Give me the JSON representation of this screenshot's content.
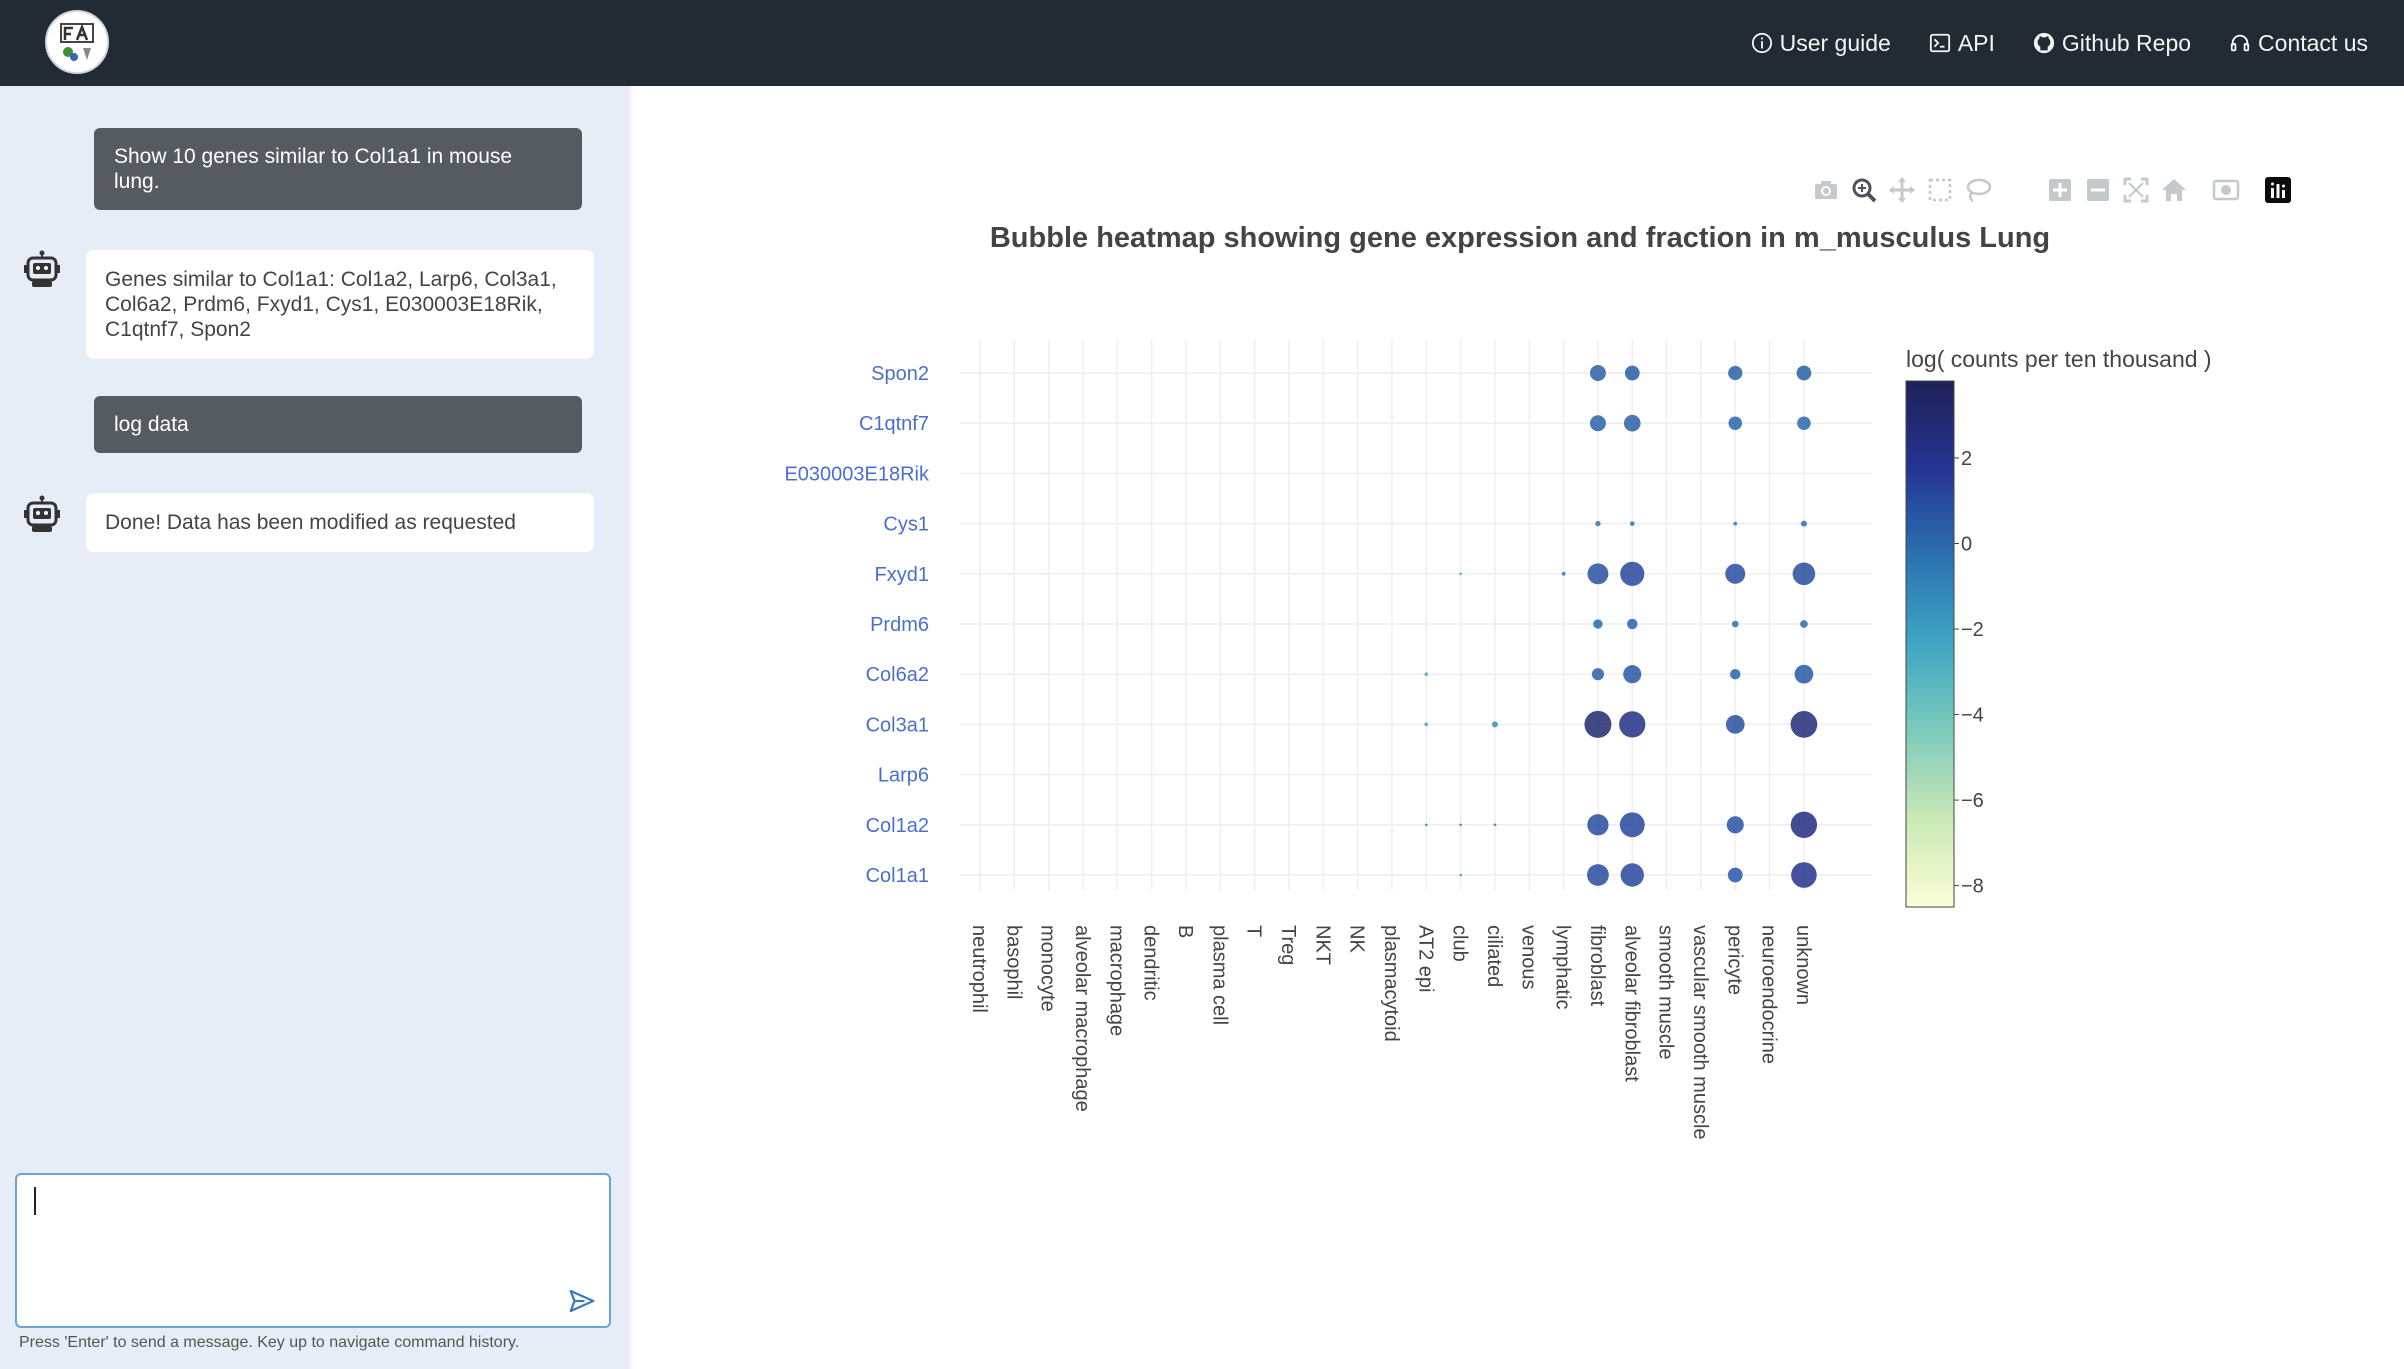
{
  "navbar": {
    "links": [
      {
        "label": "User guide",
        "icon": "info-icon"
      },
      {
        "label": "API",
        "icon": "terminal-icon"
      },
      {
        "label": "Github Repo",
        "icon": "github-icon"
      },
      {
        "label": "Contact us",
        "icon": "headset-icon"
      }
    ]
  },
  "chat": {
    "messages": [
      {
        "role": "user",
        "text": "Show 10 genes similar to Col1a1 in mouse lung."
      },
      {
        "role": "bot",
        "text": "Genes similar to Col1a1: Col1a2, Larp6, Col3a1, Col6a2, Prdm6, Fxyd1, Cys1, E030003E18Rik, C1qtnf7, Spon2"
      },
      {
        "role": "user",
        "text": "log data"
      },
      {
        "role": "bot",
        "text": "Done! Data has been modified as requested"
      }
    ],
    "input_value": "",
    "hint": "Press 'Enter' to send a message. Key up to navigate command history."
  },
  "modebar": {
    "icons": [
      "camera-icon",
      "zoom-icon",
      "pan-icon",
      "box-select-icon",
      "lasso-icon",
      "zoom-in-icon",
      "zoom-out-icon",
      "autoscale-icon",
      "home-icon",
      "screenshot-icon",
      "plotly-logo-icon"
    ],
    "active": "zoom-icon"
  },
  "chart_data": {
    "type": "bubble-heatmap",
    "title": "Bubble heatmap showing gene expression and fraction in m_musculus Lung",
    "genes": [
      "Spon2",
      "C1qtnf7",
      "E030003E18Rik",
      "Cys1",
      "Fxyd1",
      "Prdm6",
      "Col6a2",
      "Col3a1",
      "Larp6",
      "Col1a2",
      "Col1a1"
    ],
    "cell_types": [
      "neutrophil",
      "basophil",
      "monocyte",
      "alveolar macrophage",
      "macrophage",
      "dendritic",
      "B",
      "plasma cell",
      "T",
      "Treg",
      "NKT",
      "NK",
      "plasmacytoid",
      "AT2 epi",
      "club",
      "ciliated",
      "venous",
      "lymphatic",
      "fibroblast",
      "alveolar fibroblast",
      "smooth muscle",
      "vascular smooth muscle",
      "pericyte",
      "neuroendocrine",
      "unknown"
    ],
    "colorbar": {
      "title": "log( counts per ten thousand )",
      "range": [
        -8.5,
        3.8
      ],
      "ticks": [
        2,
        0,
        -2,
        -4,
        -6,
        -8
      ],
      "colorscale": [
        "#fcfdd6",
        "#c9e9b6",
        "#7dcbbb",
        "#3fa6c3",
        "#2b72b0",
        "#253494",
        "#1f2257"
      ]
    },
    "points": [
      {
        "gene": "Spon2",
        "cell": "fibroblast",
        "value": 0.3,
        "fraction": 0.35
      },
      {
        "gene": "Spon2",
        "cell": "alveolar fibroblast",
        "value": 0.5,
        "fraction": 0.3
      },
      {
        "gene": "Spon2",
        "cell": "pericyte",
        "value": 0.3,
        "fraction": 0.28
      },
      {
        "gene": "Spon2",
        "cell": "unknown",
        "value": 0.4,
        "fraction": 0.3
      },
      {
        "gene": "C1qtnf7",
        "cell": "fibroblast",
        "value": 0.2,
        "fraction": 0.35
      },
      {
        "gene": "C1qtnf7",
        "cell": "alveolar fibroblast",
        "value": 0.3,
        "fraction": 0.38
      },
      {
        "gene": "C1qtnf7",
        "cell": "pericyte",
        "value": 0.1,
        "fraction": 0.25
      },
      {
        "gene": "C1qtnf7",
        "cell": "unknown",
        "value": 0.1,
        "fraction": 0.25
      },
      {
        "gene": "Cys1",
        "cell": "fibroblast",
        "value": -0.5,
        "fraction": 0.04
      },
      {
        "gene": "Cys1",
        "cell": "alveolar fibroblast",
        "value": -0.5,
        "fraction": 0.03
      },
      {
        "gene": "Cys1",
        "cell": "pericyte",
        "value": -0.5,
        "fraction": 0.02
      },
      {
        "gene": "Cys1",
        "cell": "unknown",
        "value": -0.3,
        "fraction": 0.05
      },
      {
        "gene": "Fxyd1",
        "cell": "club",
        "value": -1.0,
        "fraction": 0.005
      },
      {
        "gene": "Fxyd1",
        "cell": "lymphatic",
        "value": -0.5,
        "fraction": 0.02
      },
      {
        "gene": "Fxyd1",
        "cell": "fibroblast",
        "value": 0.8,
        "fraction": 0.6
      },
      {
        "gene": "Fxyd1",
        "cell": "alveolar fibroblast",
        "value": 1.2,
        "fraction": 0.8
      },
      {
        "gene": "Fxyd1",
        "cell": "pericyte",
        "value": 0.9,
        "fraction": 0.55
      },
      {
        "gene": "Fxyd1",
        "cell": "unknown",
        "value": 1.0,
        "fraction": 0.7
      },
      {
        "gene": "Prdm6",
        "cell": "fibroblast",
        "value": 0.0,
        "fraction": 0.12
      },
      {
        "gene": "Prdm6",
        "cell": "alveolar fibroblast",
        "value": 0.2,
        "fraction": 0.15
      },
      {
        "gene": "Prdm6",
        "cell": "pericyte",
        "value": -0.2,
        "fraction": 0.06
      },
      {
        "gene": "Prdm6",
        "cell": "unknown",
        "value": -0.2,
        "fraction": 0.08
      },
      {
        "gene": "Col6a2",
        "cell": "AT2 epi",
        "value": -3.0,
        "fraction": 0.02
      },
      {
        "gene": "Col6a2",
        "cell": "fibroblast",
        "value": 0.3,
        "fraction": 0.2
      },
      {
        "gene": "Col6a2",
        "cell": "alveolar fibroblast",
        "value": 0.6,
        "fraction": 0.45
      },
      {
        "gene": "Col6a2",
        "cell": "pericyte",
        "value": 0.2,
        "fraction": 0.15
      },
      {
        "gene": "Col6a2",
        "cell": "unknown",
        "value": 0.6,
        "fraction": 0.48
      },
      {
        "gene": "Col3a1",
        "cell": "AT2 epi",
        "value": -2.5,
        "fraction": 0.02
      },
      {
        "gene": "Col3a1",
        "cell": "ciliated",
        "value": -1.5,
        "fraction": 0.05
      },
      {
        "gene": "Col3a1",
        "cell": "fibroblast",
        "value": 3.0,
        "fraction": 1.0
      },
      {
        "gene": "Col3a1",
        "cell": "alveolar fibroblast",
        "value": 2.3,
        "fraction": 0.95
      },
      {
        "gene": "Col3a1",
        "cell": "pericyte",
        "value": 0.8,
        "fraction": 0.48
      },
      {
        "gene": "Col3a1",
        "cell": "unknown",
        "value": 2.7,
        "fraction": 0.98
      },
      {
        "gene": "Col1a2",
        "cell": "AT2 epi",
        "value": -1.0,
        "fraction": 0.01
      },
      {
        "gene": "Col1a2",
        "cell": "club",
        "value": -1.0,
        "fraction": 0.01
      },
      {
        "gene": "Col1a2",
        "cell": "ciliated",
        "value": -1.0,
        "fraction": 0.01
      },
      {
        "gene": "Col1a2",
        "cell": "fibroblast",
        "value": 1.0,
        "fraction": 0.62
      },
      {
        "gene": "Col1a2",
        "cell": "alveolar fibroblast",
        "value": 1.2,
        "fraction": 0.85
      },
      {
        "gene": "Col1a2",
        "cell": "pericyte",
        "value": 0.7,
        "fraction": 0.4
      },
      {
        "gene": "Col1a2",
        "cell": "unknown",
        "value": 2.5,
        "fraction": 0.95
      },
      {
        "gene": "Col1a1",
        "cell": "club",
        "value": -1.0,
        "fraction": 0.005
      },
      {
        "gene": "Col1a1",
        "cell": "fibroblast",
        "value": 1.0,
        "fraction": 0.65
      },
      {
        "gene": "Col1a1",
        "cell": "alveolar fibroblast",
        "value": 1.1,
        "fraction": 0.75
      },
      {
        "gene": "Col1a1",
        "cell": "pericyte",
        "value": 0.6,
        "fraction": 0.3
      },
      {
        "gene": "Col1a1",
        "cell": "unknown",
        "value": 2.0,
        "fraction": 0.9
      }
    ]
  }
}
